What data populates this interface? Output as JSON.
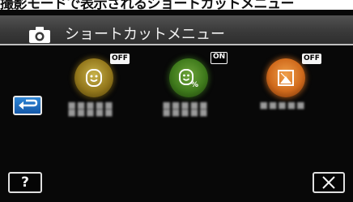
{
  "caption": "撮影モードで表示されるショートカットメニュー",
  "titlebar": {
    "camera_icon": "camera-icon",
    "title": "ショートカットメニュー"
  },
  "items": [
    {
      "icon": "smile-face-icon",
      "badge": "OFF",
      "state": "off",
      "label": "■■■■■ ■■■■■"
    },
    {
      "icon": "smile-percent-icon",
      "badge": "ON",
      "state": "on",
      "label": "■■■■■ ■■■■■"
    },
    {
      "icon": "scene-icon",
      "badge": "OFF",
      "state": "off",
      "label": "■■■■■"
    }
  ],
  "buttons": {
    "return_icon": "return-arrow-icon",
    "help_label": "?",
    "close_icon": "close-x-icon"
  },
  "colors": {
    "screen_bg": "#080808",
    "return_blue": "#1f6fc4"
  }
}
